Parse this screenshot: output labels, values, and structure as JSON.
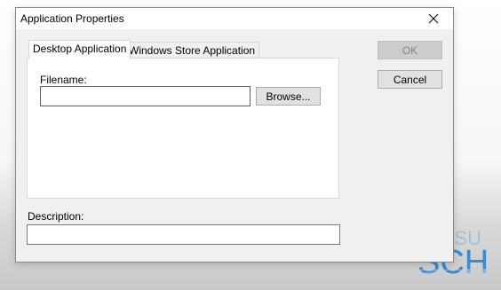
{
  "dialog": {
    "title": "Application Properties",
    "close_icon": "close-icon"
  },
  "tabs": [
    {
      "label": "Desktop Application",
      "active": true
    },
    {
      "label": "Windows Store Application",
      "active": false
    }
  ],
  "filename": {
    "label": "Filename:",
    "value": "",
    "browse_label": "Browse..."
  },
  "description": {
    "label": "Description:",
    "value": ""
  },
  "buttons": {
    "ok_label": "OK",
    "ok_enabled": false,
    "cancel_label": "Cancel"
  },
  "background": {
    "logo_text_lines": [
      "TSU",
      "SCH"
    ],
    "accent_color": "#0a72c4"
  }
}
